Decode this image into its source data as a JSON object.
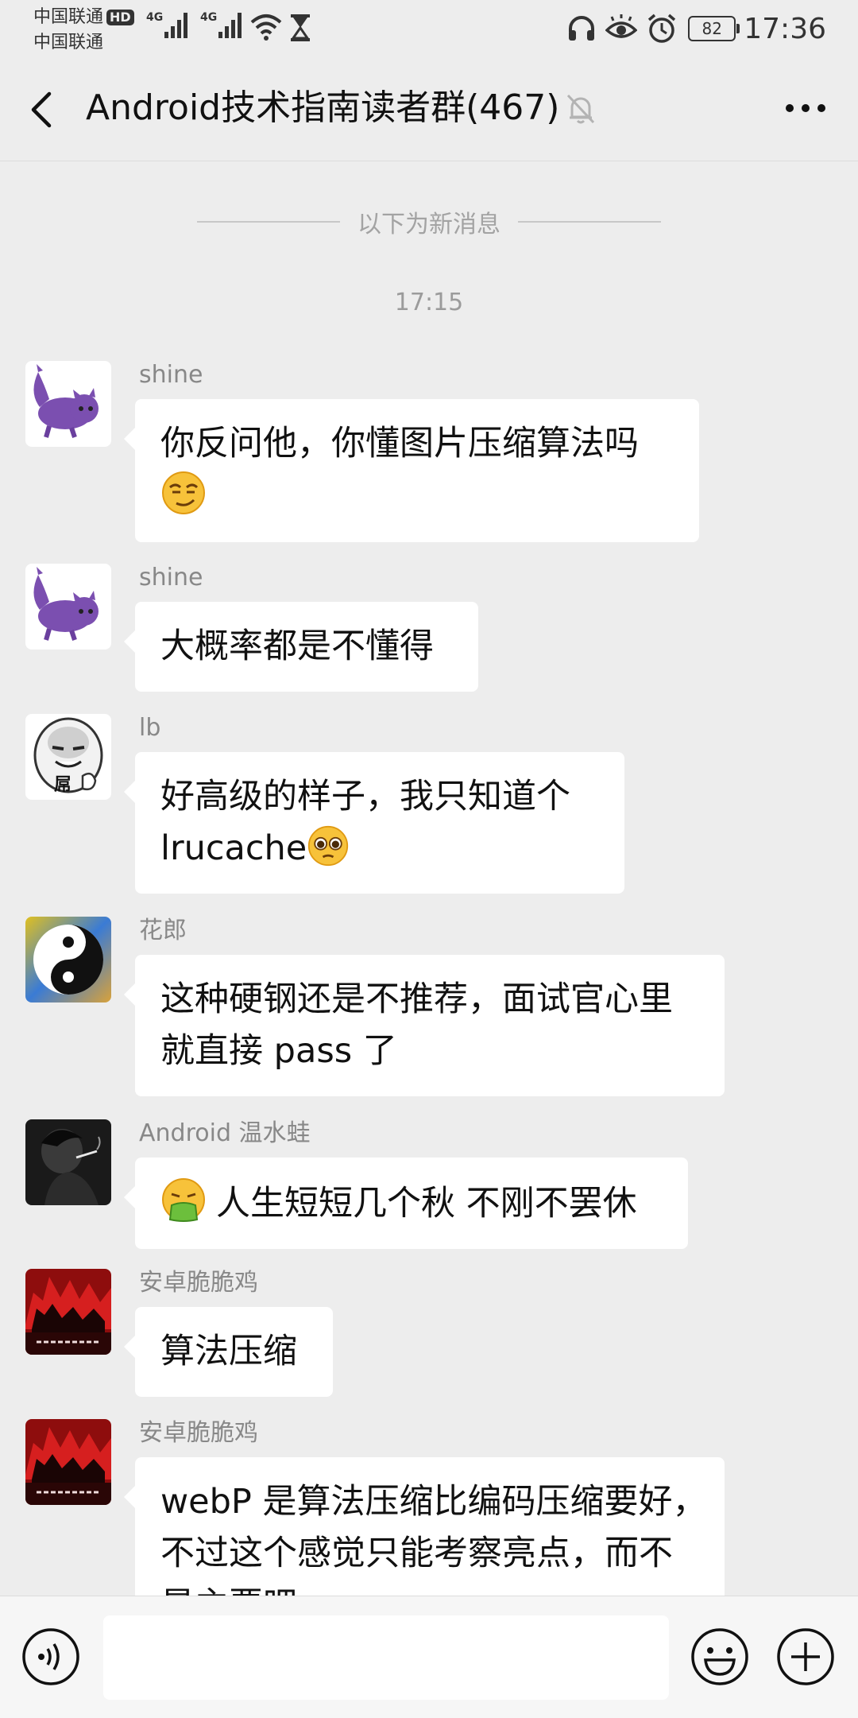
{
  "status_bar": {
    "carrier_1": "中国联通",
    "carrier_2": "中国联通",
    "hd_label": "HD",
    "network_1": "4G",
    "network_2": "4G",
    "battery_level": "82",
    "time": "17:36"
  },
  "header": {
    "title": "Android技术指南读者群(467)",
    "back_icon": "chevron-left-icon",
    "mute_icon": "bell-off-icon",
    "more_icon": "more-horizontal-icon"
  },
  "chat": {
    "new_messages_divider": "以下为新消息",
    "time_label": "17:15",
    "messages": [
      {
        "sender": "shine",
        "avatar": "purple-cat-avatar",
        "lines": [
          "你反问他，你懂图片压缩算法吗"
        ],
        "emoji": "smirk-emoji"
      },
      {
        "sender": "shine",
        "avatar": "purple-cat-avatar",
        "lines": [
          "大概率都是不懂得"
        ]
      },
      {
        "sender": "lb",
        "avatar": "meme-face-avatar",
        "avatar_text": "屌",
        "lines": [
          "好高级的样子，我只知道个",
          "lrucache"
        ],
        "emoji": "pleading-emoji"
      },
      {
        "sender": "花郎",
        "avatar": "yin-yang-avatar",
        "lines": [
          "这种硬钢还是不推荐，面试官心里",
          "就直接 pass 了"
        ]
      },
      {
        "sender": "Android 温水蛙",
        "avatar": "dark-portrait-avatar",
        "lines": [
          "人生短短几个秋 不刚不罢休"
        ],
        "emoji": "vomit-emoji"
      },
      {
        "sender": "安卓脆脆鸡",
        "avatar": "red-poster-avatar",
        "lines": [
          "算法压缩"
        ]
      },
      {
        "sender": "安卓脆脆鸡",
        "avatar": "red-poster-avatar",
        "lines": [
          "webP 是算法压缩比编码压缩要好，",
          "不过这个感觉只能考察亮点，而不",
          "是主要吧"
        ]
      }
    ]
  },
  "input_bar": {
    "voice_icon": "voice-icon",
    "input_value": "",
    "emoji_icon": "emoji-icon",
    "plus_icon": "plus-icon"
  }
}
